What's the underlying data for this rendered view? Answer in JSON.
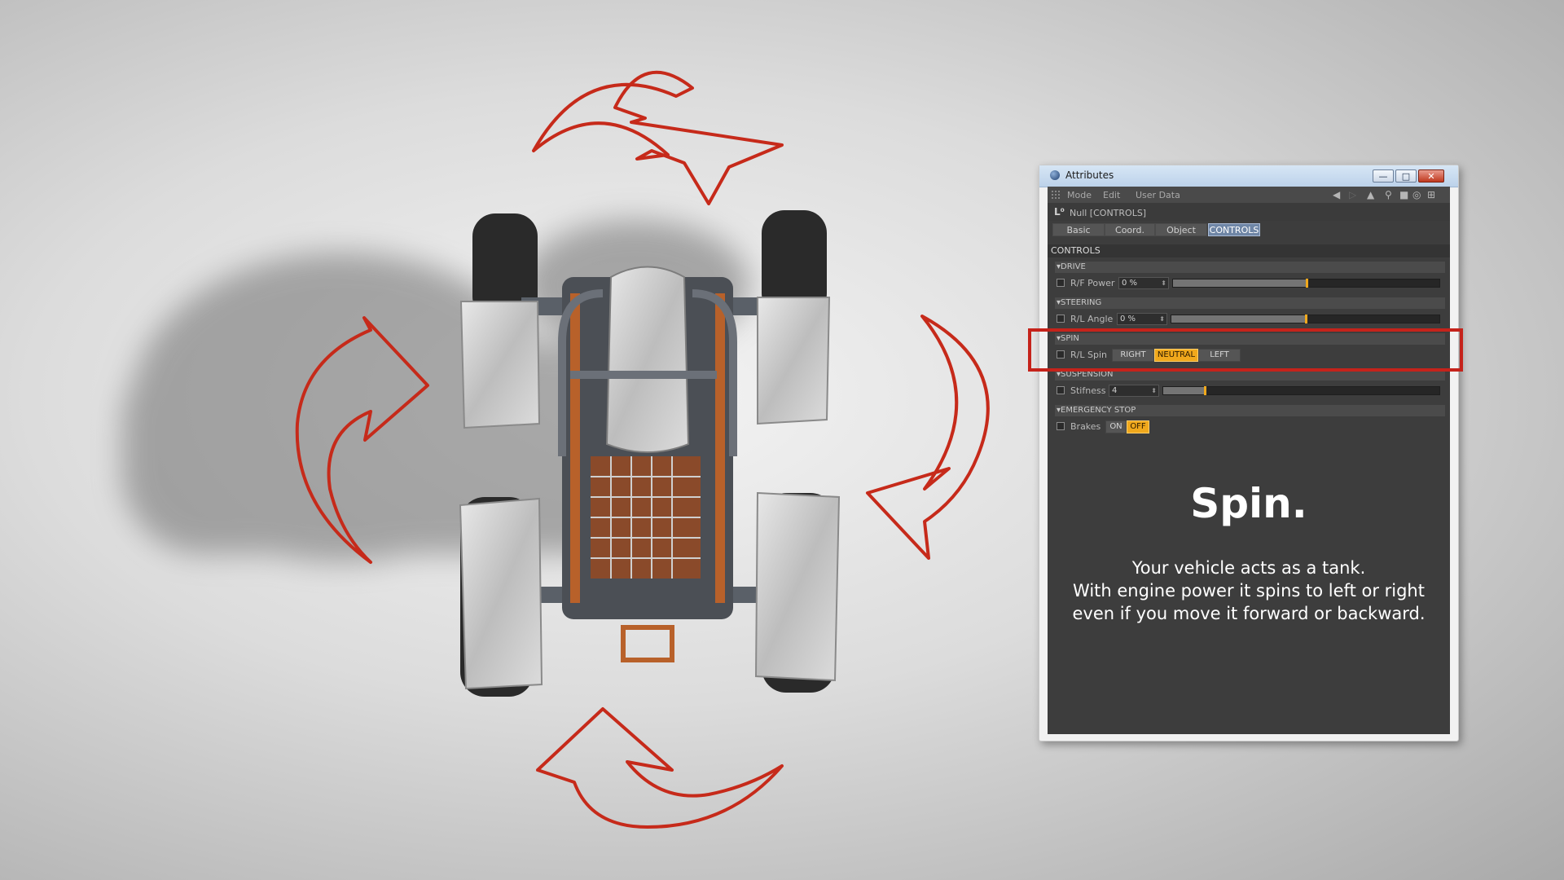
{
  "window": {
    "title": "Attributes",
    "controls": {
      "minimize": "—",
      "maximize": "□",
      "close": "✕"
    }
  },
  "menu": {
    "items": [
      "Mode",
      "Edit",
      "User Data"
    ],
    "tool_icons": [
      "back-arrow-icon",
      "forward-arrow-icon",
      "up-arrow-icon",
      "search-icon",
      "lock-icon",
      "target-icon",
      "new-window-icon"
    ]
  },
  "object": {
    "name": "Null [CONTROLS]"
  },
  "tabs": [
    "Basic",
    "Coord.",
    "Object",
    "CONTROLS"
  ],
  "active_tab": "CONTROLS",
  "section": "CONTROLS",
  "groups": {
    "drive": {
      "title": "DRIVE",
      "label": "R/F Power",
      "value": "0 %",
      "level": 0.5
    },
    "steering": {
      "title": "STEERING",
      "label": "R/L Angle",
      "value": "0 %",
      "level": 0.5
    },
    "spin": {
      "title": "SPIN",
      "label": "R/L Spin",
      "options": [
        "RIGHT",
        "NEUTRAL",
        "LEFT"
      ],
      "selected": "NEUTRAL"
    },
    "suspension": {
      "title": "SUSPENSION",
      "label": "Stifness",
      "value": "4",
      "level": 0.15
    },
    "emergency": {
      "title": "EMERGENCY STOP",
      "label": "Brakes",
      "options": [
        "ON",
        "OFF"
      ],
      "selected": "OFF"
    }
  },
  "info": {
    "title": "Spin.",
    "body": "Your vehicle acts as a tank.\nWith engine power it spins to left or right\neven if you move it forward or backward."
  },
  "colors": {
    "accent": "#f0a81c",
    "highlight": "#c5231b",
    "arrow": "#c62a1a",
    "panel": "#3d3d3d"
  }
}
